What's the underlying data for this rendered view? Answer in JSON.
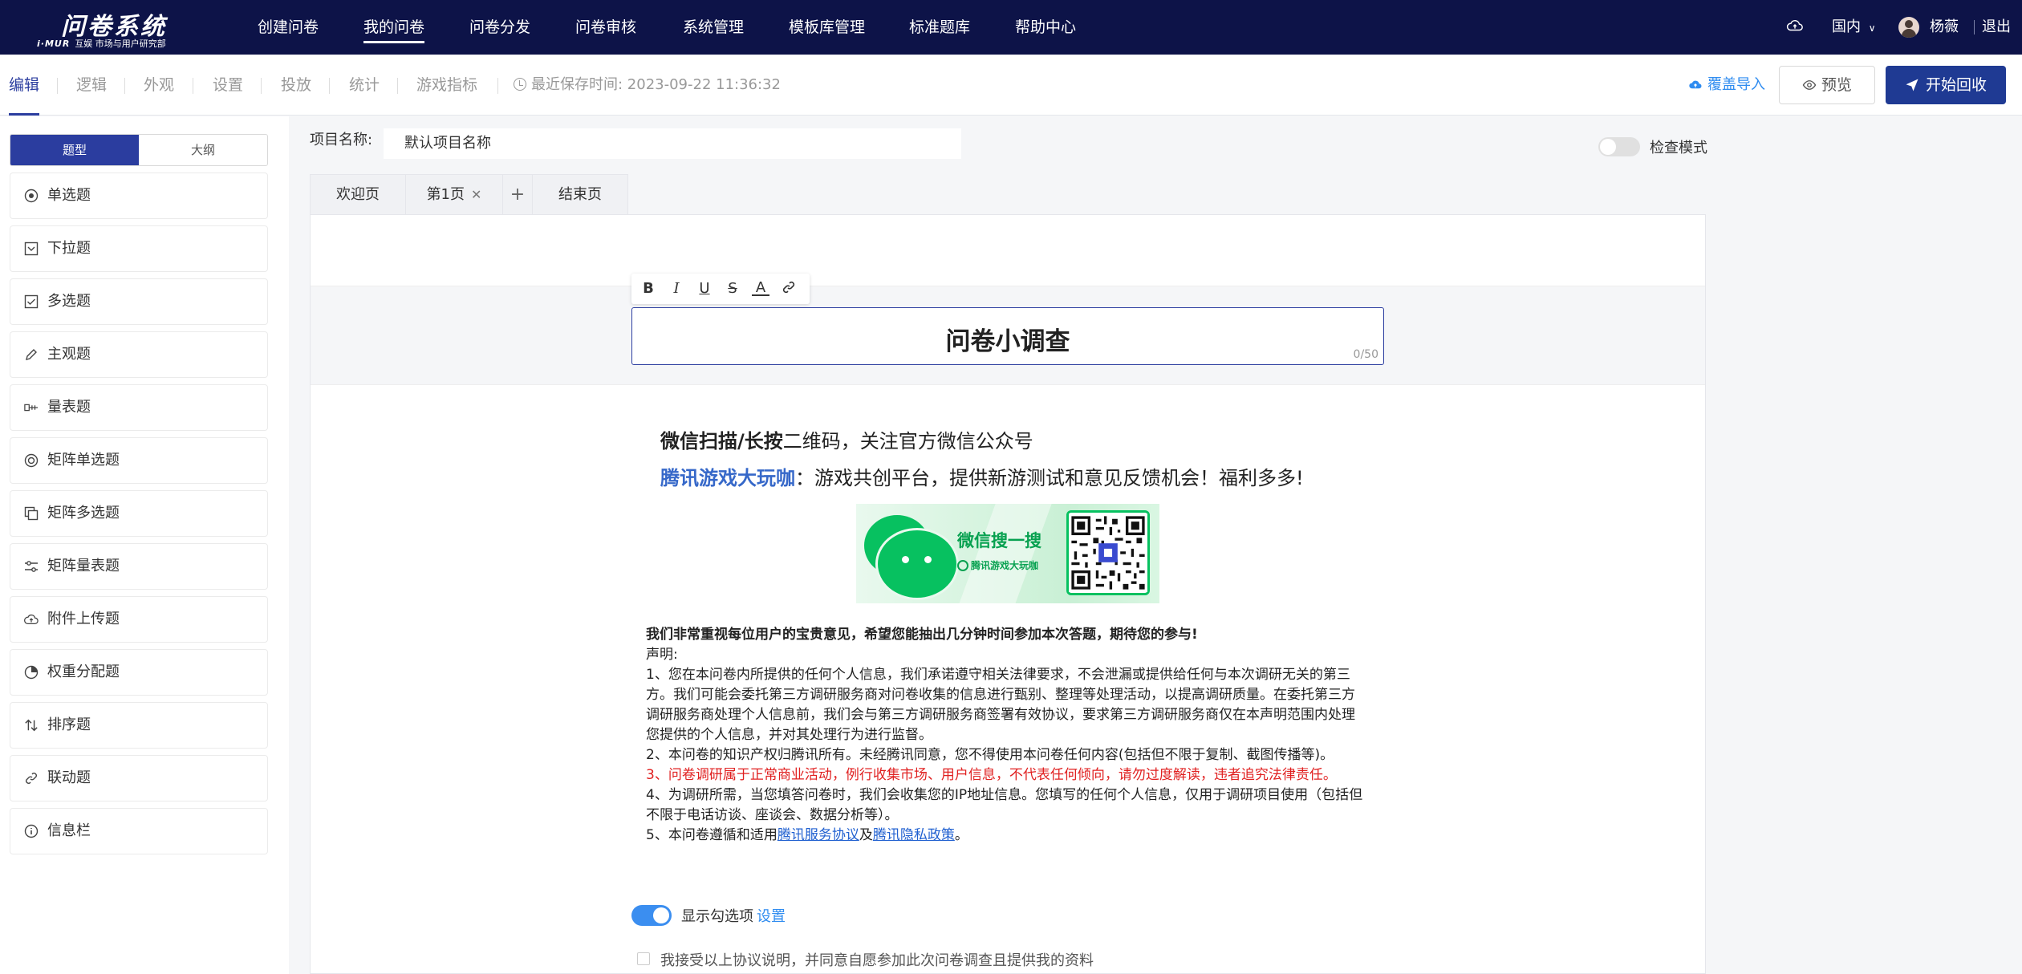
{
  "header": {
    "logo_title": "问卷系统",
    "logo_brand": "i·MUR",
    "logo_subtitle": "互娱 市场与用户研究部",
    "nav": [
      "创建问卷",
      "我的问卷",
      "问卷分发",
      "问卷审核",
      "系统管理",
      "模板库管理",
      "标准题库",
      "帮助中心"
    ],
    "active_nav": "我的问卷",
    "region": "国内",
    "username": "杨薇",
    "logout": "退出"
  },
  "toolbar": {
    "tabs": [
      "编辑",
      "逻辑",
      "外观",
      "设置",
      "投放",
      "统计",
      "游戏指标"
    ],
    "active_tab": "编辑",
    "saved_text": "最近保存时间: 2023-09-22 11:36:32",
    "import_label": "覆盖导入",
    "preview_label": "预览",
    "start_label": "开始回收"
  },
  "sidebar": {
    "seg_on": "题型",
    "seg_off": "大纲",
    "items": [
      {
        "label": "单选题",
        "icon": "radio-icon"
      },
      {
        "label": "下拉题",
        "icon": "dropdown-icon"
      },
      {
        "label": "多选题",
        "icon": "checkbox-icon"
      },
      {
        "label": "主观题",
        "icon": "pencil-icon"
      },
      {
        "label": "量表题",
        "icon": "scale-icon"
      },
      {
        "label": "矩阵单选题",
        "icon": "matrix-radio-icon"
      },
      {
        "label": "矩阵多选题",
        "icon": "matrix-checkbox-icon"
      },
      {
        "label": "矩阵量表题",
        "icon": "matrix-scale-icon"
      },
      {
        "label": "附件上传题",
        "icon": "upload-icon"
      },
      {
        "label": "权重分配题",
        "icon": "pie-icon"
      },
      {
        "label": "排序题",
        "icon": "sort-icon"
      },
      {
        "label": "联动题",
        "icon": "link-icon"
      },
      {
        "label": "信息栏",
        "icon": "info-icon"
      }
    ]
  },
  "project": {
    "label": "项目名称:",
    "value": "默认项目名称",
    "check_mode": "检查模式"
  },
  "pages": {
    "welcome": "欢迎页",
    "page1": "第1页",
    "add": "+",
    "end": "结束页"
  },
  "survey": {
    "title": "问卷小调查",
    "count": "0/50",
    "wx_bold": "微信扫描/长按",
    "wx_rest": "二维码，关注官方微信公众号",
    "wx_brand": "腾讯游戏大玩咖",
    "wx_desc": "：游戏共创平台，提供新游测试和意见反馈机会！福利多多!",
    "banner_title": "微信搜一搜",
    "banner_search": "腾讯游戏大玩咖",
    "notice_head": "我们非常重视每位用户的宝贵意见，希望您能抽出几分钟时间参加本次答题，期待您的参与!",
    "notice_label": "声明:",
    "notice_1": "1、您在本问卷内所提供的任何个人信息，我们承诺遵守相关法律要求，不会泄漏或提供给任何与本次调研无关的第三方。我们可能会委托第三方调研服务商对问卷收集的信息进行甄别、整理等处理活动，以提高调研质量。在委托第三方调研服务商处理个人信息前，我们会与第三方调研服务商签署有效协议，要求第三方调研服务商仅在本声明范围内处理您提供的个人信息，并对其处理行为进行监督。",
    "notice_2": "2、本问卷的知识产权归腾讯所有。未经腾讯同意，您不得使用本问卷任何内容(包括但不限于复制、截图传播等)。",
    "notice_3": "3、问卷调研属于正常商业活动，例行收集市场、用户信息，不代表任何倾向，请勿过度解读，违者追究法律责任。",
    "notice_4": "4、为调研所需，当您填答问卷时，我们会收集您的IP地址信息。您填写的任何个人信息，仅用于调研项目使用（包括但不限于电话访谈、座谈会、数据分析等）。",
    "notice_5_pre": "5、本问卷遵循和适用",
    "notice_5_link1": "腾讯服务协议",
    "notice_5_mid": "及",
    "notice_5_link2": "腾讯隐私政策",
    "notice_5_end": "。",
    "show_option_label": "显示勾选项",
    "show_option_set": "设置",
    "agree_text": "我接受以上协议说明，并同意自愿参加此次问卷调查且提供我的资料"
  },
  "colors": {
    "nav_bg": "#0d1348",
    "accent": "#2b3d9f",
    "link": "#2f8cf0",
    "wechat_green": "#07c160",
    "warning_red": "#e02020"
  }
}
